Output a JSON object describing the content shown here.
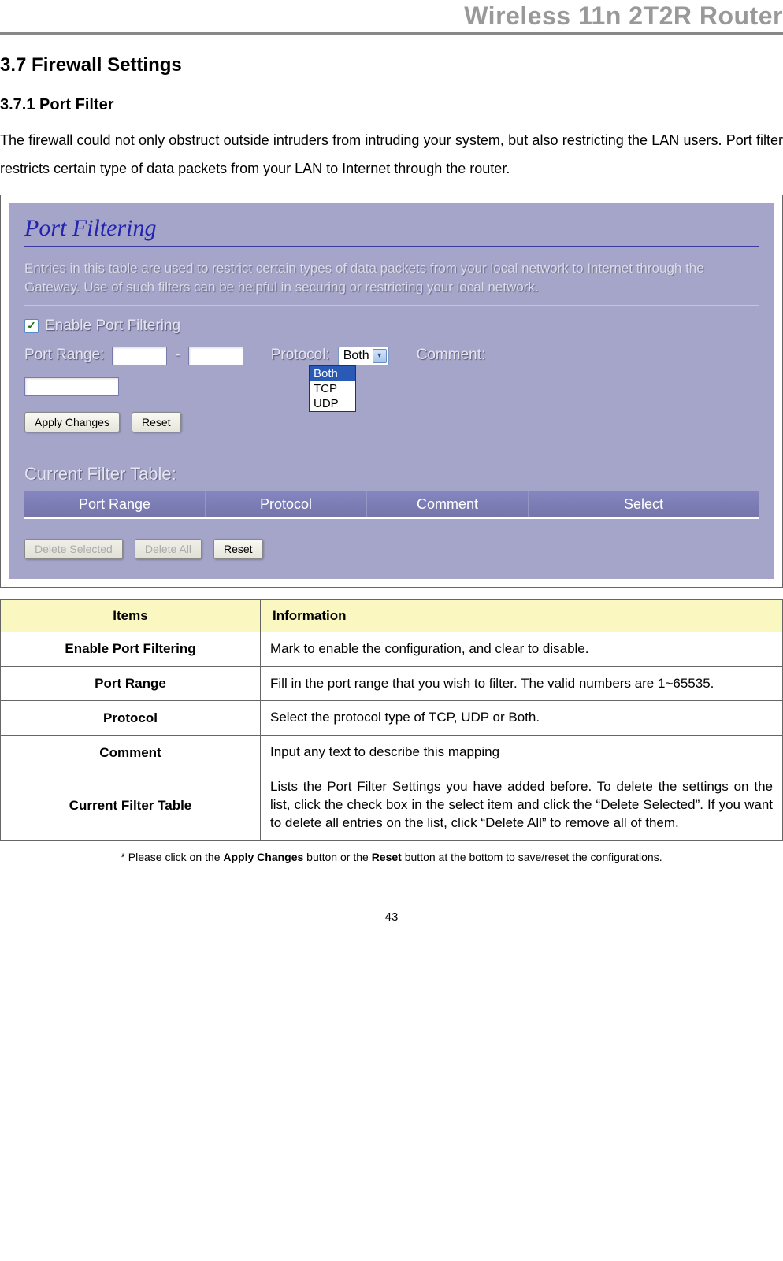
{
  "header": {
    "title": "Wireless 11n 2T2R Router"
  },
  "section": {
    "number_title": "3.7    Firewall Settings",
    "sub_number_title": "3.7.1  Port Filter",
    "paragraph": "The firewall could not only obstruct outside intruders from intruding your system, but also restricting the LAN users. Port filter restricts certain type of data packets from your LAN to Internet through the router."
  },
  "screenshot": {
    "title": "Port Filtering",
    "description": "Entries in this table are used to restrict certain types of data packets from your local network to Internet through the Gateway. Use of such filters can be helpful in securing or restricting your local network.",
    "enable_label": "Enable Port Filtering",
    "port_range_label": "Port Range:",
    "dash": "-",
    "protocol_label": "Protocol:",
    "protocol_selected": "Both",
    "protocol_options": [
      "Both",
      "TCP",
      "UDP"
    ],
    "comment_label": "Comment:",
    "apply_button": "Apply Changes",
    "reset_button": "Reset",
    "table_title": "Current Filter Table:",
    "table_headers": {
      "port": "Port Range",
      "protocol": "Protocol",
      "comment": "Comment",
      "select": "Select"
    },
    "delete_selected": "Delete Selected",
    "delete_all": "Delete All",
    "reset2": "Reset"
  },
  "info_table": {
    "header_items": "Items",
    "header_info": "Information",
    "rows": [
      {
        "item": "Enable Port Filtering",
        "desc": "Mark to enable the configuration, and clear to disable."
      },
      {
        "item": "Port Range",
        "desc": "Fill in the port range that you wish to filter. The valid numbers are 1~65535."
      },
      {
        "item": "Protocol",
        "desc": "Select the protocol type of TCP, UDP or Both."
      },
      {
        "item": "Comment",
        "desc": "Input any text to describe this mapping"
      },
      {
        "item": "Current Filter Table",
        "desc": "Lists the Port Filter Settings you have added before. To delete the settings on the list, click the check box in the select item and click the “Delete Selected”. If you want to delete all entries on the list, click “Delete All” to remove all of them."
      }
    ]
  },
  "footnote": {
    "prefix": "* Please click on the ",
    "bold1": "Apply Changes",
    "mid": " button or the ",
    "bold2": "Reset",
    "suffix": " button at the bottom to save/reset the configurations."
  },
  "page_number": "43"
}
